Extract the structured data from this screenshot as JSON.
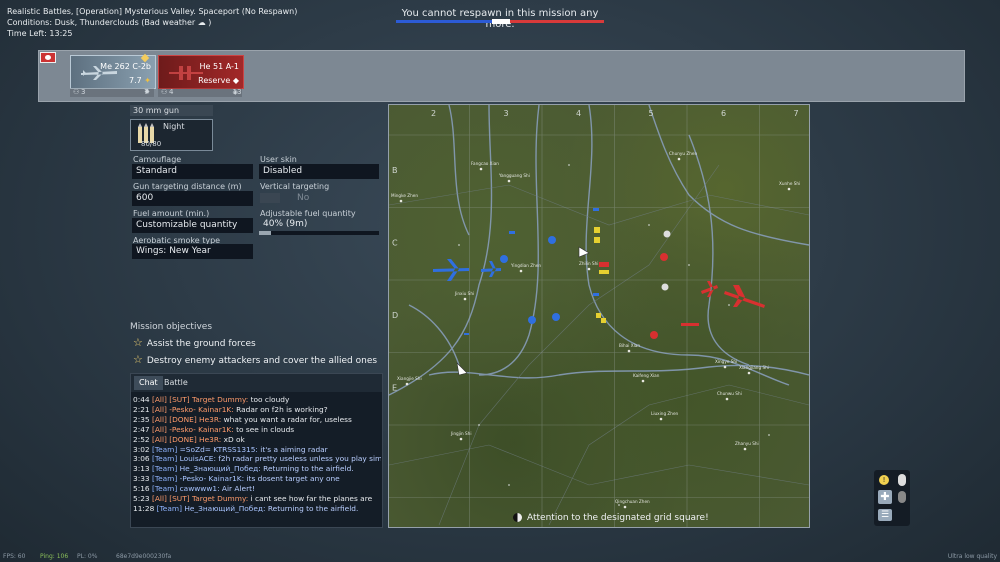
{
  "mission": {
    "title": "Realistic Battles, [Operation] Mysterious Valley. Spaceport (No Respawn)",
    "conditions": "Conditions: Dusk, Thunderclouds  (Bad weather",
    "conditions_end": ")",
    "time_left": "Time Left: 13:25"
  },
  "top_message": "You cannot respawn in this mission any more.",
  "slots": [
    {
      "name": "Me 262 C-2b",
      "sub": "7.7",
      "foot_left": "3",
      "foot_right": "7"
    },
    {
      "name": "He 51 A-1",
      "sub": "Reserve",
      "foot_left": "4",
      "foot_right": "13"
    }
  ],
  "weapons": {
    "gun_header": "30 mm gun",
    "ammo_name": "Night",
    "ammo_count": "80/80"
  },
  "settings": {
    "camouflage_label": "Camouflage",
    "camouflage_value": "Standard",
    "gun_target_label": "Gun targeting distance (m)",
    "gun_target_value": "600",
    "fuel_label": "Fuel amount (min.)",
    "fuel_value": "Customizable quantity",
    "smoke_label": "Aerobatic smoke type",
    "smoke_value": "Wings: New Year",
    "skin_label": "User skin",
    "skin_value": "Disabled",
    "vert_label": "Vertical targeting",
    "vert_value": "No",
    "adj_fuel_label": "Adjustable fuel quantity",
    "adj_fuel_value": "40% (9m)",
    "adj_fuel_fraction": 0.1
  },
  "objectives": {
    "title": "Mission objectives",
    "items": [
      "Assist the ground forces",
      "Destroy enemy attackers and cover the allied ones"
    ]
  },
  "chat": {
    "tabs": [
      "Chat",
      "Battle"
    ],
    "lines": [
      {
        "time": "0:44",
        "tag": "[All]",
        "kind": "all",
        "name": "[SUT] Target Dummy:",
        "msg": "too cloudy"
      },
      {
        "time": "2:21",
        "tag": "[All]",
        "kind": "all",
        "name": "-Pesko- Kainar1K:",
        "msg": "Radar on f2h is working?"
      },
      {
        "time": "2:35",
        "tag": "[All]",
        "kind": "all",
        "name": "[DONE] He3R:",
        "msg": "what you want a radar for, useless"
      },
      {
        "time": "2:47",
        "tag": "[All]",
        "kind": "all",
        "name": "-Pesko- Kainar1K:",
        "msg": "to see in clouds"
      },
      {
        "time": "2:52",
        "tag": "[All]",
        "kind": "all",
        "name": "[DONE] He3R:",
        "msg": "xD ok"
      },
      {
        "time": "3:02",
        "tag": "[Team]",
        "kind": "team",
        "name": "=SoZd= KTRSS1315:",
        "msg": "it's a aiming radar"
      },
      {
        "time": "3:06",
        "tag": "[Team]",
        "kind": "team",
        "name": "LouisACE:",
        "msg": "f2h radar pretty useless unless you play sim"
      },
      {
        "time": "3:13",
        "tag": "[Team]",
        "kind": "team",
        "name": "Не_Знающий_Побед:",
        "msg": "Returning to the airfield."
      },
      {
        "time": "3:33",
        "tag": "[Team]",
        "kind": "team",
        "name": "-Pesko- Kainar1K:",
        "msg": "its dosent target any one"
      },
      {
        "time": "5:16",
        "tag": "[Team]",
        "kind": "team",
        "name": "cawwww1:",
        "msg": "Air Alert!"
      },
      {
        "time": "5:23",
        "tag": "[All]",
        "kind": "all",
        "name": "[SUT] Target Dummy:",
        "msg": "i cant see how far the planes are"
      },
      {
        "time": "11:28",
        "tag": "[Team]",
        "kind": "team",
        "name": "Не_Знающий_Побед:",
        "msg": "Returning to the airfield."
      }
    ]
  },
  "map": {
    "col_labels": [
      "2",
      "3",
      "4",
      "5",
      "6",
      "7"
    ],
    "row_labels": [
      "B",
      "C",
      "D",
      "E"
    ],
    "towns": [
      "Fangcao Xian",
      "Yangguang Shi",
      "Chunyu Zhen",
      "Xunhe Shi",
      "Mingke Zhen",
      "Yingdian Zhen",
      "Jinxiu Shi",
      "Bihai Xian",
      "Xingye Shi",
      "Xiangjie Shi",
      "Xiangjiang Shi",
      "Kaifeng Xian",
      "Chunwu Shi",
      "Liuxing Zhen",
      "Jingjin Shi",
      "Zhanyu Shi",
      "Qingchuan Zhen",
      "Zhilin Shi"
    ],
    "hint": "Attention to the designated grid square!"
  },
  "footer": {
    "fps": "FPS: 60",
    "ping": "Ping: 106",
    "pl": "PL: 0%",
    "session": "68e7d9e000230fa",
    "quality": "Ultra low quality"
  },
  "colors": {
    "allied": "#2f6fe0",
    "enemy": "#d83030",
    "objective": "#f0d070"
  }
}
